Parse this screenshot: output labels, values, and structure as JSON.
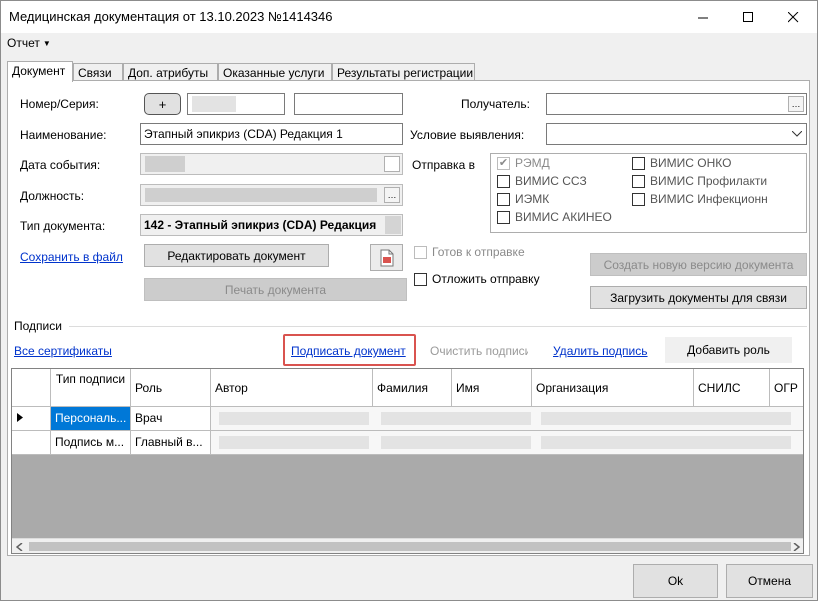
{
  "window": {
    "title": "Медицинская документация от 13.10.2023 №1414346"
  },
  "menu": {
    "report": "Отчет"
  },
  "tabs": [
    {
      "label": "Документ"
    },
    {
      "label": "Связи"
    },
    {
      "label": "Доп. атрибуты"
    },
    {
      "label": "Оказанные услуги"
    },
    {
      "label": "Результаты регистрации"
    }
  ],
  "form": {
    "number_label": "Номер/Серия:",
    "plus": "+",
    "name_label": "Наименование:",
    "name_value": "Этапный эпикриз (CDA) Редакция 1",
    "event_date_label": "Дата события:",
    "position_label": "Должность:",
    "doc_type_label": "Тип документа:",
    "doc_type_value": "142 - Этапный эпикриз (CDA) Редакция",
    "save_to_file": "Сохранить в файл",
    "edit_document": "Редактировать документ",
    "print_document": "Печать документа",
    "recipient_label": "Получатель:",
    "condition_label": "Условие выявления:",
    "send_to_label": "Отправка в",
    "send_targets": [
      {
        "label": "РЭМД",
        "checked": true
      },
      {
        "label": "ВИМИС ОНКО",
        "checked": false
      },
      {
        "label": "ВИМИС ССЗ",
        "checked": false
      },
      {
        "label": "ВИМИС Профилакти",
        "checked": false
      },
      {
        "label": "ИЭМК",
        "checked": false
      },
      {
        "label": "ВИМИС Инфекционн",
        "checked": false
      },
      {
        "label": "ВИМИС АКИНЕО",
        "checked": false
      }
    ],
    "ready_to_send": "Готов к отправке",
    "delay_send": "Отложить отправку",
    "create_new_version": "Создать новую версию документа",
    "load_docs_for_link": "Загрузить документы для связи"
  },
  "signatures": {
    "section_label": "Подписи",
    "all_certificates": "Все сертификаты",
    "sign_document": "Подписать документ",
    "clear_signature": "Очистить подписи",
    "delete_signature": "Удалить подпись",
    "add_role": "Добавить роль",
    "columns": [
      "Тип подписи",
      "Роль",
      "Автор",
      "Фамилия",
      "Имя",
      "Организация",
      "СНИЛС",
      "ОГР"
    ],
    "rows": [
      {
        "type": "Персональ...",
        "role": "Врач"
      },
      {
        "type": "Подпись м...",
        "role": "Главный в..."
      }
    ]
  },
  "footer": {
    "ok": "Ok",
    "cancel": "Отмена"
  },
  "colors": {
    "accent": "#0078d7",
    "link": "#0033cc",
    "highlight_border": "#d9534f"
  }
}
